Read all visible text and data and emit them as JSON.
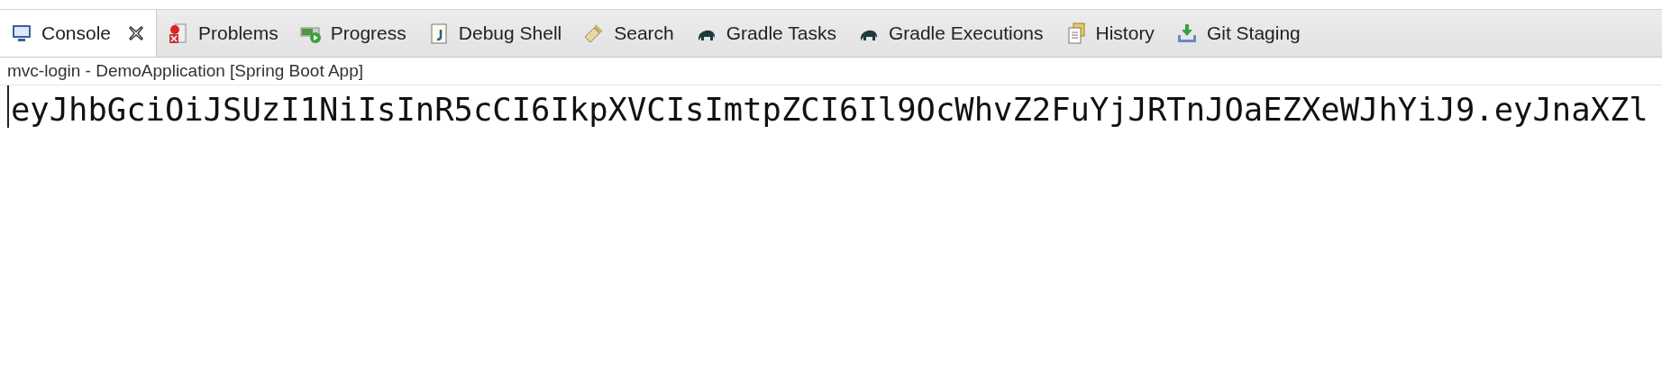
{
  "tabs": [
    {
      "label": "Console",
      "selected": true
    },
    {
      "label": "Problems",
      "selected": false
    },
    {
      "label": "Progress",
      "selected": false
    },
    {
      "label": "Debug Shell",
      "selected": false
    },
    {
      "label": "Search",
      "selected": false
    },
    {
      "label": "Gradle Tasks",
      "selected": false
    },
    {
      "label": "Gradle Executions",
      "selected": false
    },
    {
      "label": "History",
      "selected": false
    },
    {
      "label": "Git Staging",
      "selected": false
    }
  ],
  "console": {
    "title": "mvc-login - DemoApplication [Spring Boot App]",
    "output": "eyJhbGciOiJSUzI1NiIsInR5cCI6IkpXVCIsImtpZCI6Il9OcWhvZ2FuYjJRTnJOaEZXeWJhYiJ9.eyJnaXZl"
  }
}
